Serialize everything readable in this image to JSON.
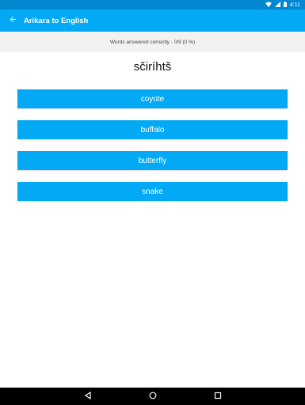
{
  "status_bar": {
    "time": "4:11",
    "icons": [
      "wifi-icon",
      "signal-icon",
      "battery-icon"
    ]
  },
  "app_bar": {
    "title": "Arikara to English",
    "back_icon": "arrow-back-icon"
  },
  "score": {
    "text": "Words answered correctly - 0/9 (0 %)"
  },
  "question": {
    "word": "sčiríhtš"
  },
  "answers": [
    {
      "label": "coyote"
    },
    {
      "label": "buffalo"
    },
    {
      "label": "butterfly"
    },
    {
      "label": "snake"
    }
  ],
  "nav_bar": {
    "icons": [
      "back-triangle-icon",
      "home-circle-icon",
      "recents-square-icon"
    ]
  },
  "colors": {
    "primary": "#03a9f4",
    "primary_dark": "#0288d1",
    "score_bg": "#f2f2f2"
  }
}
